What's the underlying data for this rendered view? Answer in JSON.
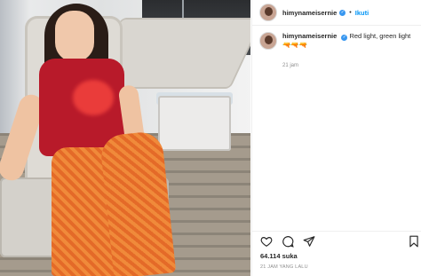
{
  "post": {
    "username": "himynameisernie",
    "follow_label": "Ikuti",
    "separator": "•",
    "caption_text": "Red light, green light 🔫🔫🔫",
    "time_short": "21 jam",
    "likes": "64.114 suka",
    "time_long": "21 JAM YANG LALU"
  },
  "icons": {
    "verified": "verified-badge-icon",
    "like": "heart-icon",
    "comment": "comment-icon",
    "share": "paper-plane-icon",
    "save": "bookmark-icon"
  },
  "colors": {
    "link": "#0095f6",
    "verified": "#3897f0",
    "muted": "#8e8e8e",
    "text": "#262626"
  }
}
